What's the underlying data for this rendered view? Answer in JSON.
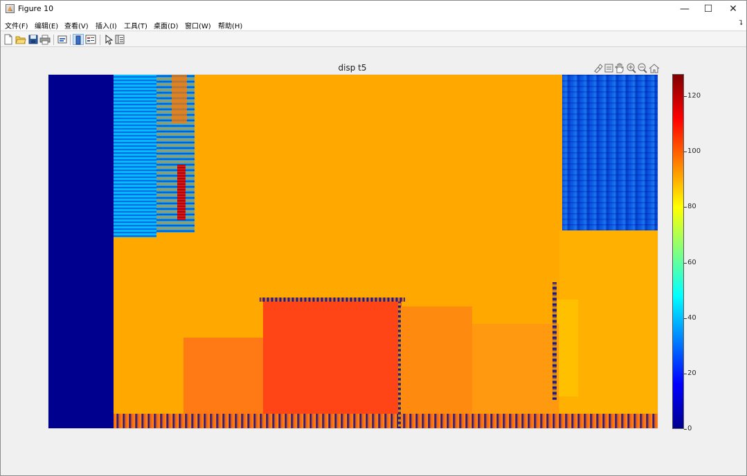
{
  "window": {
    "title": "Figure 10",
    "controls": {
      "minimize": "—",
      "maximize": "☐",
      "close": "✕"
    }
  },
  "menubar": {
    "items": [
      "文件(F)",
      "编辑(E)",
      "查看(V)",
      "插入(I)",
      "工具(T)",
      "桌面(D)",
      "窗口(W)",
      "帮助(H)"
    ],
    "overflow_icon": "chevron-double-icon"
  },
  "toolbar": {
    "buttons": [
      "new-figure-icon",
      "open-file-icon",
      "save-icon",
      "print-icon",
      "link-plot-icon",
      "insert-colorbar-icon",
      "insert-legend-icon",
      "edit-plot-icon",
      "property-inspector-icon"
    ]
  },
  "axes": {
    "title": "disp t5",
    "toolbar": [
      "brush-icon",
      "datatip-icon",
      "pan-icon",
      "zoom-in-icon",
      "zoom-out-icon",
      "home-icon"
    ]
  },
  "colorbar": {
    "colormap": "jet",
    "range": [
      0,
      128
    ],
    "ticks": [
      0,
      20,
      40,
      60,
      80,
      100,
      120
    ],
    "tick_labels": [
      "0",
      "20",
      "40",
      "60",
      "80",
      "100",
      "120"
    ]
  },
  "colors": {
    "background_orange": "#ffa800",
    "left_band": "#00008f",
    "cyan_region": "#00c8ff",
    "red_box": "#ff4416",
    "orange_box": "#ff8a10",
    "blue_region": "#1466e6"
  }
}
